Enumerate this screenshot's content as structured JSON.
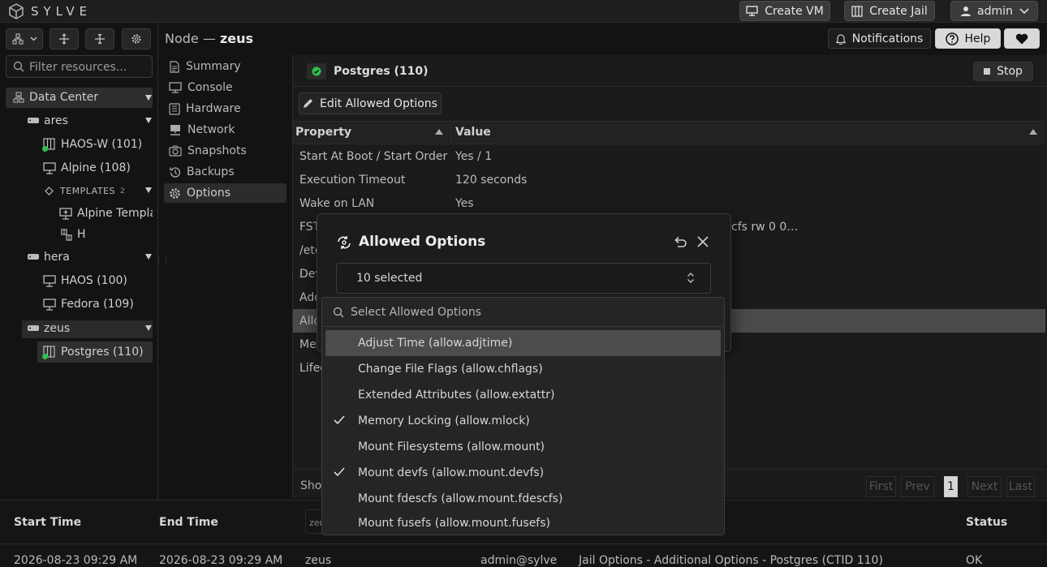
{
  "brand": "SYLVE",
  "topbar": {
    "create_vm": "Create VM",
    "create_jail": "Create Jail",
    "user": "admin",
    "notifications": "Notifications",
    "help": "Help"
  },
  "sidebar": {
    "filter_placeholder": "Filter resources...",
    "datacenter": "Data Center",
    "nodes": [
      {
        "name": "ares",
        "items": [
          "HAOS-W (101)",
          "Alpine (108)"
        ],
        "templates_label": "TEMPLATES",
        "templates_count": "2",
        "templates": [
          "Alpine Templat",
          "H"
        ]
      },
      {
        "name": "hera",
        "items": [
          "HAOS (100)",
          "Fedora (109)"
        ]
      },
      {
        "name": "zeus",
        "items": [
          "Postgres (110)"
        ]
      }
    ]
  },
  "breadcrumb": {
    "prefix": "Node — ",
    "node": "zeus"
  },
  "nav": [
    "Summary",
    "Console",
    "Hardware",
    "Network",
    "Snapshots",
    "Backups",
    "Options"
  ],
  "panel": {
    "title": "Postgres (110)",
    "stop": "Stop",
    "edit": "Edit Allowed Options",
    "col_property": "Property",
    "col_value": "Value",
    "rows": [
      {
        "p": "Start At Boot / Start Order",
        "v": "Yes / 1"
      },
      {
        "p": "Execution Timeout",
        "v": "120 seconds"
      },
      {
        "p": "Wake on LAN",
        "v": "Yes"
      },
      {
        "p": "FST",
        "v": "cfs rw 0 0…"
      },
      {
        "p": "/etc",
        "v": ""
      },
      {
        "p": "Dev",
        "v": ""
      },
      {
        "p": "Add",
        "v": ""
      },
      {
        "p": "Allo",
        "v": ""
      },
      {
        "p": "Me",
        "v": ""
      },
      {
        "p": "Lifec",
        "v": ""
      }
    ],
    "show": "Show",
    "pager": {
      "first": "First",
      "prev": "Prev",
      "page": "1",
      "next": "Next",
      "last": "Last"
    }
  },
  "dialog": {
    "title": "Allowed Options",
    "selected": "10 selected",
    "search_placeholder": "Select Allowed Options",
    "options": [
      {
        "label": "Adjust Time (allow.adjtime)",
        "checked": false
      },
      {
        "label": "Change File Flags (allow.chflags)",
        "checked": false
      },
      {
        "label": "Extended Attributes (allow.extattr)",
        "checked": false
      },
      {
        "label": "Memory Locking (allow.mlock)",
        "checked": true
      },
      {
        "label": "Mount Filesystems (allow.mount)",
        "checked": false
      },
      {
        "label": "Mount devfs (allow.mount.devfs)",
        "checked": true
      },
      {
        "label": "Mount fdescfs (allow.mount.fdescfs)",
        "checked": false
      },
      {
        "label": "Mount fusefs (allow.mount.fusefs)",
        "checked": false
      }
    ]
  },
  "log": {
    "headers": [
      "Start Time",
      "End Time",
      "Status"
    ],
    "node_partial": "zeu",
    "row": {
      "start": "2026-08-23 09:29 AM",
      "end": "2026-08-23 09:29 AM",
      "node": "zeus",
      "user": "admin@sylve",
      "action": "Jail Options - Additional Options - Postgres (CTID 110)",
      "status": "OK"
    }
  }
}
